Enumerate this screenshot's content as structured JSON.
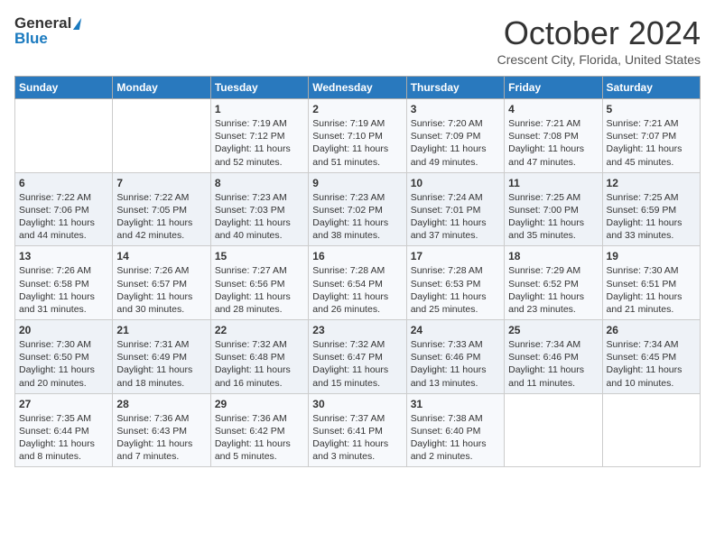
{
  "logo": {
    "line1": "General",
    "line2": "Blue"
  },
  "header": {
    "month": "October 2024",
    "location": "Crescent City, Florida, United States"
  },
  "weekdays": [
    "Sunday",
    "Monday",
    "Tuesday",
    "Wednesday",
    "Thursday",
    "Friday",
    "Saturday"
  ],
  "weeks": [
    [
      {
        "day": "",
        "sunrise": "",
        "sunset": "",
        "daylight": ""
      },
      {
        "day": "",
        "sunrise": "",
        "sunset": "",
        "daylight": ""
      },
      {
        "day": "1",
        "sunrise": "Sunrise: 7:19 AM",
        "sunset": "Sunset: 7:12 PM",
        "daylight": "Daylight: 11 hours and 52 minutes."
      },
      {
        "day": "2",
        "sunrise": "Sunrise: 7:19 AM",
        "sunset": "Sunset: 7:10 PM",
        "daylight": "Daylight: 11 hours and 51 minutes."
      },
      {
        "day": "3",
        "sunrise": "Sunrise: 7:20 AM",
        "sunset": "Sunset: 7:09 PM",
        "daylight": "Daylight: 11 hours and 49 minutes."
      },
      {
        "day": "4",
        "sunrise": "Sunrise: 7:21 AM",
        "sunset": "Sunset: 7:08 PM",
        "daylight": "Daylight: 11 hours and 47 minutes."
      },
      {
        "day": "5",
        "sunrise": "Sunrise: 7:21 AM",
        "sunset": "Sunset: 7:07 PM",
        "daylight": "Daylight: 11 hours and 45 minutes."
      }
    ],
    [
      {
        "day": "6",
        "sunrise": "Sunrise: 7:22 AM",
        "sunset": "Sunset: 7:06 PM",
        "daylight": "Daylight: 11 hours and 44 minutes."
      },
      {
        "day": "7",
        "sunrise": "Sunrise: 7:22 AM",
        "sunset": "Sunset: 7:05 PM",
        "daylight": "Daylight: 11 hours and 42 minutes."
      },
      {
        "day": "8",
        "sunrise": "Sunrise: 7:23 AM",
        "sunset": "Sunset: 7:03 PM",
        "daylight": "Daylight: 11 hours and 40 minutes."
      },
      {
        "day": "9",
        "sunrise": "Sunrise: 7:23 AM",
        "sunset": "Sunset: 7:02 PM",
        "daylight": "Daylight: 11 hours and 38 minutes."
      },
      {
        "day": "10",
        "sunrise": "Sunrise: 7:24 AM",
        "sunset": "Sunset: 7:01 PM",
        "daylight": "Daylight: 11 hours and 37 minutes."
      },
      {
        "day": "11",
        "sunrise": "Sunrise: 7:25 AM",
        "sunset": "Sunset: 7:00 PM",
        "daylight": "Daylight: 11 hours and 35 minutes."
      },
      {
        "day": "12",
        "sunrise": "Sunrise: 7:25 AM",
        "sunset": "Sunset: 6:59 PM",
        "daylight": "Daylight: 11 hours and 33 minutes."
      }
    ],
    [
      {
        "day": "13",
        "sunrise": "Sunrise: 7:26 AM",
        "sunset": "Sunset: 6:58 PM",
        "daylight": "Daylight: 11 hours and 31 minutes."
      },
      {
        "day": "14",
        "sunrise": "Sunrise: 7:26 AM",
        "sunset": "Sunset: 6:57 PM",
        "daylight": "Daylight: 11 hours and 30 minutes."
      },
      {
        "day": "15",
        "sunrise": "Sunrise: 7:27 AM",
        "sunset": "Sunset: 6:56 PM",
        "daylight": "Daylight: 11 hours and 28 minutes."
      },
      {
        "day": "16",
        "sunrise": "Sunrise: 7:28 AM",
        "sunset": "Sunset: 6:54 PM",
        "daylight": "Daylight: 11 hours and 26 minutes."
      },
      {
        "day": "17",
        "sunrise": "Sunrise: 7:28 AM",
        "sunset": "Sunset: 6:53 PM",
        "daylight": "Daylight: 11 hours and 25 minutes."
      },
      {
        "day": "18",
        "sunrise": "Sunrise: 7:29 AM",
        "sunset": "Sunset: 6:52 PM",
        "daylight": "Daylight: 11 hours and 23 minutes."
      },
      {
        "day": "19",
        "sunrise": "Sunrise: 7:30 AM",
        "sunset": "Sunset: 6:51 PM",
        "daylight": "Daylight: 11 hours and 21 minutes."
      }
    ],
    [
      {
        "day": "20",
        "sunrise": "Sunrise: 7:30 AM",
        "sunset": "Sunset: 6:50 PM",
        "daylight": "Daylight: 11 hours and 20 minutes."
      },
      {
        "day": "21",
        "sunrise": "Sunrise: 7:31 AM",
        "sunset": "Sunset: 6:49 PM",
        "daylight": "Daylight: 11 hours and 18 minutes."
      },
      {
        "day": "22",
        "sunrise": "Sunrise: 7:32 AM",
        "sunset": "Sunset: 6:48 PM",
        "daylight": "Daylight: 11 hours and 16 minutes."
      },
      {
        "day": "23",
        "sunrise": "Sunrise: 7:32 AM",
        "sunset": "Sunset: 6:47 PM",
        "daylight": "Daylight: 11 hours and 15 minutes."
      },
      {
        "day": "24",
        "sunrise": "Sunrise: 7:33 AM",
        "sunset": "Sunset: 6:46 PM",
        "daylight": "Daylight: 11 hours and 13 minutes."
      },
      {
        "day": "25",
        "sunrise": "Sunrise: 7:34 AM",
        "sunset": "Sunset: 6:46 PM",
        "daylight": "Daylight: 11 hours and 11 minutes."
      },
      {
        "day": "26",
        "sunrise": "Sunrise: 7:34 AM",
        "sunset": "Sunset: 6:45 PM",
        "daylight": "Daylight: 11 hours and 10 minutes."
      }
    ],
    [
      {
        "day": "27",
        "sunrise": "Sunrise: 7:35 AM",
        "sunset": "Sunset: 6:44 PM",
        "daylight": "Daylight: 11 hours and 8 minutes."
      },
      {
        "day": "28",
        "sunrise": "Sunrise: 7:36 AM",
        "sunset": "Sunset: 6:43 PM",
        "daylight": "Daylight: 11 hours and 7 minutes."
      },
      {
        "day": "29",
        "sunrise": "Sunrise: 7:36 AM",
        "sunset": "Sunset: 6:42 PM",
        "daylight": "Daylight: 11 hours and 5 minutes."
      },
      {
        "day": "30",
        "sunrise": "Sunrise: 7:37 AM",
        "sunset": "Sunset: 6:41 PM",
        "daylight": "Daylight: 11 hours and 3 minutes."
      },
      {
        "day": "31",
        "sunrise": "Sunrise: 7:38 AM",
        "sunset": "Sunset: 6:40 PM",
        "daylight": "Daylight: 11 hours and 2 minutes."
      },
      {
        "day": "",
        "sunrise": "",
        "sunset": "",
        "daylight": ""
      },
      {
        "day": "",
        "sunrise": "",
        "sunset": "",
        "daylight": ""
      }
    ]
  ]
}
